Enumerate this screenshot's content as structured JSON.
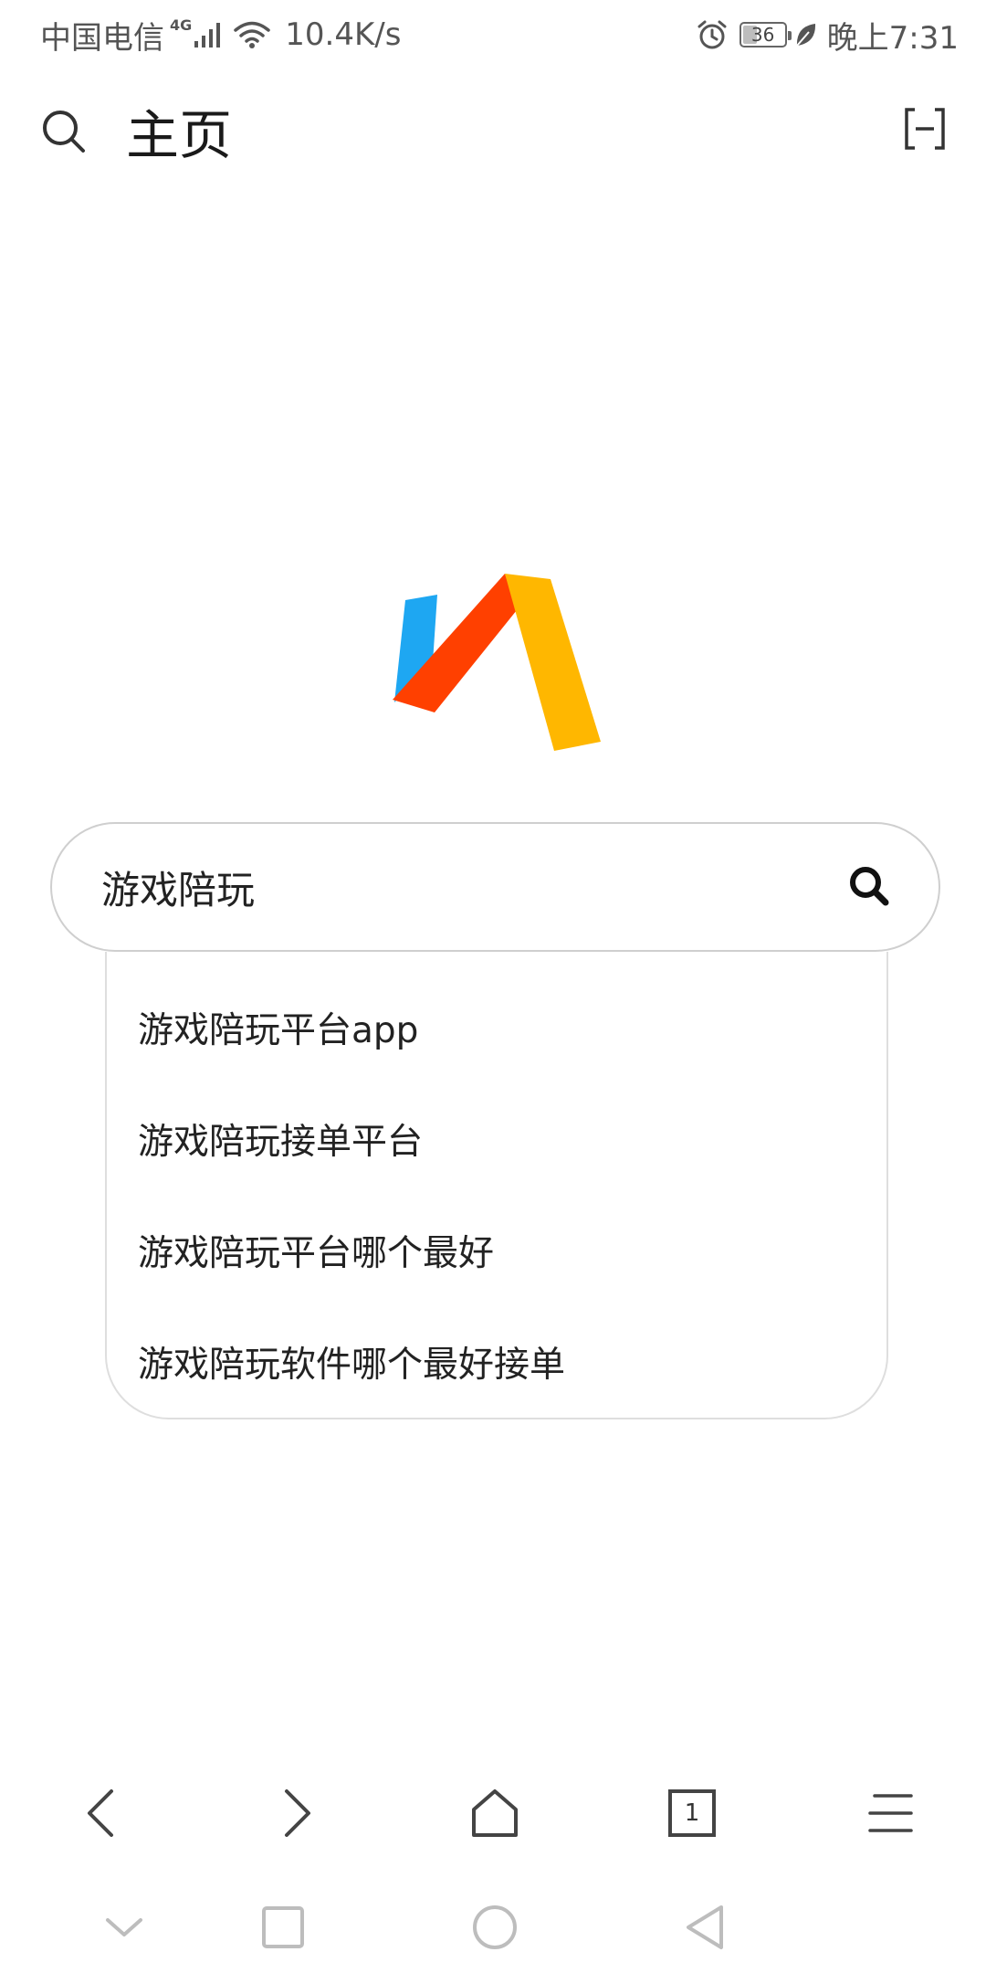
{
  "status_bar": {
    "carrier": "中国电信",
    "network_type": "4G",
    "speed": "10.4K/s",
    "battery_level": "36",
    "battery_fraction": 0.36,
    "time": "晚上7:31",
    "icons": [
      "signal-icon",
      "wifi-icon",
      "alarm-icon",
      "battery-icon",
      "leaf-icon"
    ]
  },
  "header": {
    "title": "主页",
    "left_icon": "search-icon",
    "right_icon": "scan-icon"
  },
  "logo": {
    "colors": {
      "blue": "#1ea7f2",
      "red": "#ff4000",
      "yellow": "#ffb700"
    }
  },
  "search": {
    "query": "游戏陪玩",
    "submit_icon": "search-icon"
  },
  "suggestions": [
    "游戏陪玩平台app",
    "游戏陪玩接单平台",
    "游戏陪玩平台哪个最好",
    "游戏陪玩软件哪个最好接单"
  ],
  "browser_toolbar": {
    "tab_count": "1",
    "icons": [
      "back-icon",
      "forward-icon",
      "home-icon",
      "tabs-icon",
      "menu-icon"
    ]
  },
  "system_nav": {
    "icons": [
      "collapse-icon",
      "recents-icon",
      "home-icon",
      "back-icon"
    ]
  }
}
